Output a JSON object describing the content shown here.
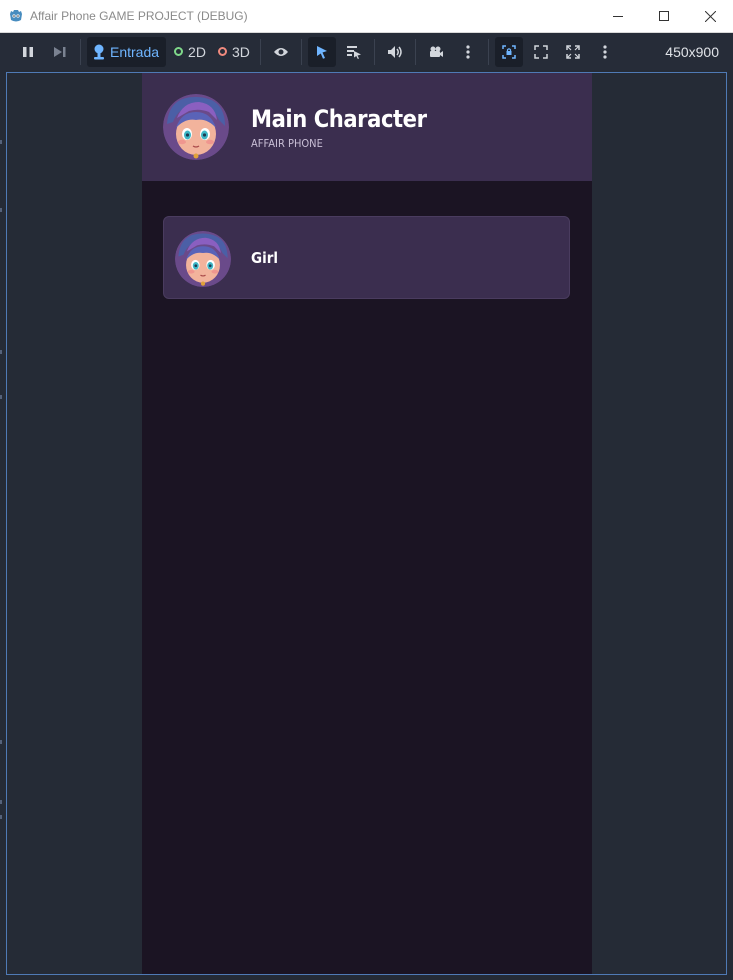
{
  "window": {
    "title": "Affair Phone GAME PROJECT (DEBUG)"
  },
  "toolbar": {
    "input_mode_label": "Entrada",
    "mode_2d_label": "2D",
    "mode_3d_label": "3D",
    "resolution": "450x900",
    "colors": {
      "accent": "#6fb5ff",
      "mode_2d": "#7fd88a",
      "mode_3d": "#f08a7e"
    }
  },
  "phone": {
    "header": {
      "title": "Main Character",
      "subtitle": "AFFAIR PHONE"
    },
    "contacts": [
      {
        "name": "Girl"
      }
    ],
    "colors": {
      "background": "#1b1423",
      "panel": "#3b2e4f"
    }
  }
}
